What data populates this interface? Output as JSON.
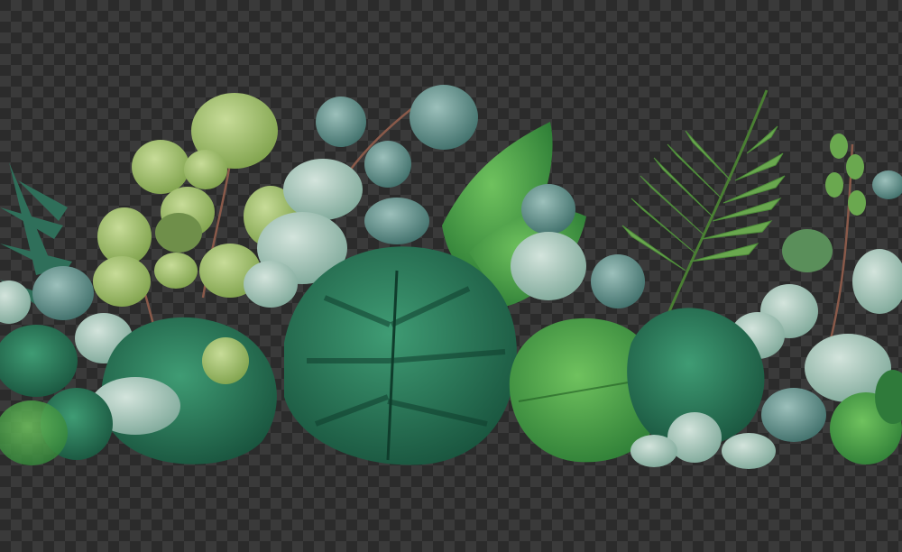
{
  "palette": {
    "checker_dark": "#2b2b2b",
    "checker_light": "#3a3a3a",
    "monstera_dark": "#1f6b4e",
    "monstera_mid": "#2f8a5f",
    "eucalyptus_sage": "#8fb8a8",
    "eucalyptus_pale": "#c9ddd3",
    "olive_leaf": "#9fc06a",
    "fern_green": "#6aa84f",
    "bright_green": "#3f9a3c",
    "stem_brown": "#8a5a4a"
  },
  "subjects": [
    "monstera-leaf",
    "eucalyptus-branch",
    "fern-frond",
    "round-leaf-cluster"
  ]
}
